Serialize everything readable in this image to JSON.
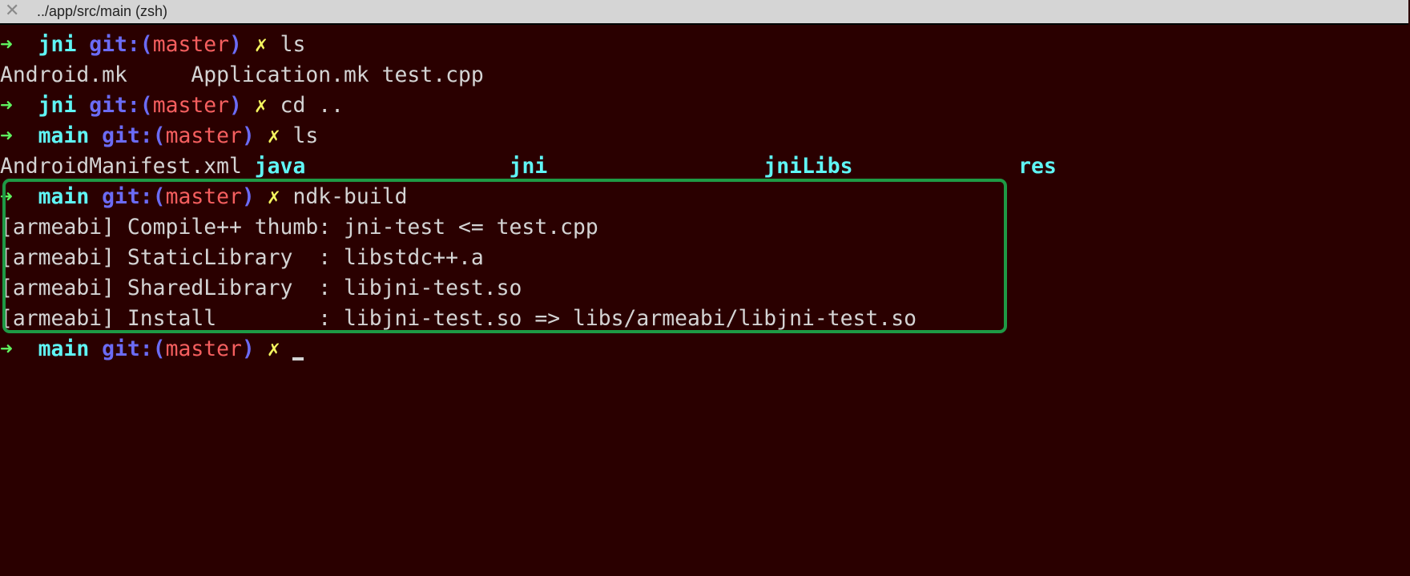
{
  "window": {
    "title": "../app/src/main (zsh)",
    "close_icon": "close-icon"
  },
  "colors": {
    "background": "#2a0000",
    "highlight_box": "#1e9a45",
    "arrow": "#5ff25f",
    "dir": "#5ff5f5",
    "git": "#6b6bf5",
    "branch": "#f55f5f",
    "dirty": "#f5f55f"
  },
  "prompt": {
    "arrow": "➜",
    "git": "git:(",
    "branch": "master",
    "close": ")",
    "dirty": "✗"
  },
  "lines": [
    {
      "dir": "jni",
      "cmd": "ls"
    },
    {
      "output": "Android.mk     Application.mk test.cpp"
    },
    {
      "dir": "jni",
      "cmd": "cd .."
    },
    {
      "dir": "main",
      "cmd": "ls"
    },
    {
      "output": "AndroidManifest.xml ",
      "dirs": [
        "java",
        "jni",
        "jniLibs",
        "res"
      ]
    },
    {
      "dir": "main",
      "cmd": "ndk-build"
    },
    {
      "output": "[armeabi] Compile++ thumb: jni-test <= test.cpp"
    },
    {
      "output": "[armeabi] StaticLibrary  : libstdc++.a"
    },
    {
      "output": "[armeabi] SharedLibrary  : libjni-test.so"
    },
    {
      "output": "[armeabi] Install        : libjni-test.so => libs/armeabi/libjni-test.so"
    },
    {
      "dir": "main",
      "cmd": ""
    }
  ]
}
